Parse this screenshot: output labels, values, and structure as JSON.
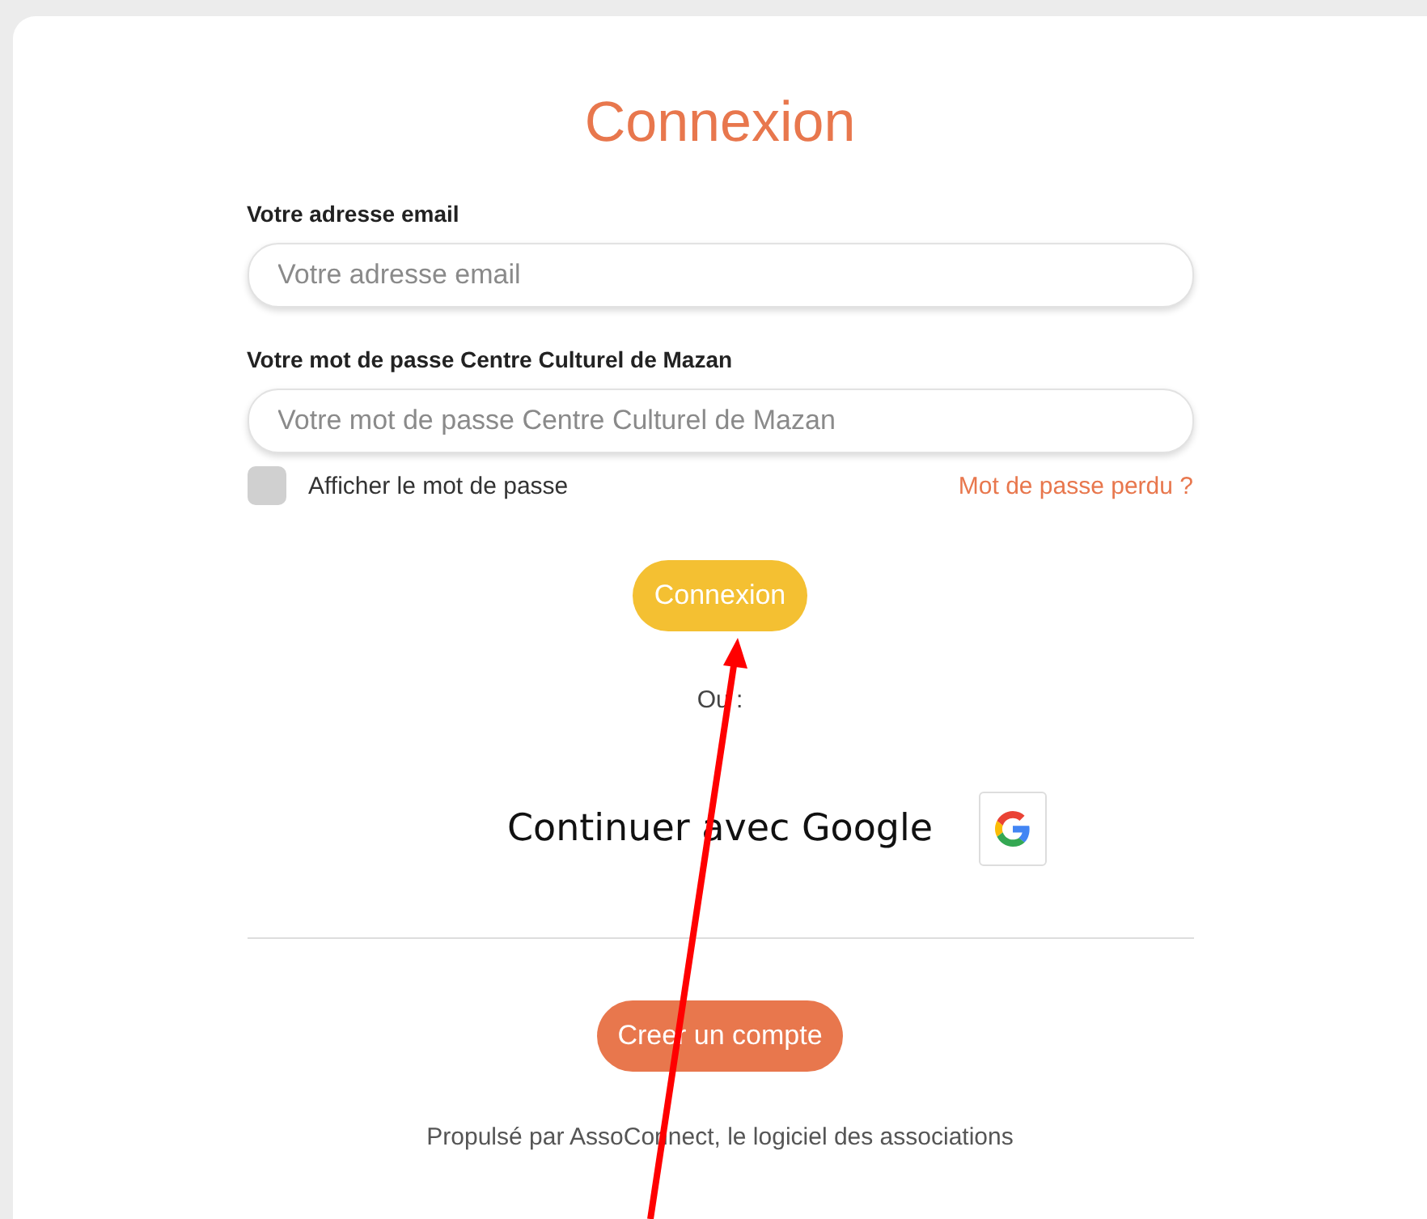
{
  "title": "Connexion",
  "fields": [
    {
      "label": "Votre adresse email",
      "placeholder": "Votre adresse email"
    },
    {
      "label": "Votre mot de passe Centre Culturel de Mazan",
      "placeholder": "Votre mot de passe Centre Culturel de Mazan"
    }
  ],
  "show_password": {
    "label": "Afficher le mot de passe",
    "checked": false
  },
  "forgot_link": "Mot de passe perdu ?",
  "login_button": "Connexion",
  "separator_text": "Ou :",
  "google_button": {
    "label": "Continuer avec Google"
  },
  "create_account_button": "Creer un compte",
  "footer": "Propulsé par AssoConnect, le logiciel des associations"
}
